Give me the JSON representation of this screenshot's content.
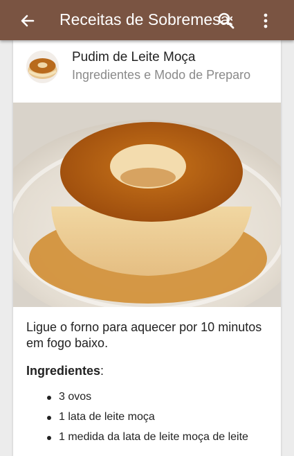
{
  "app_bar": {
    "title": "Receitas de Sobremesas",
    "bg_color": "#7a5442",
    "back_icon": "arrow-back-icon",
    "search_icon": "search-icon",
    "more_icon": "more-vert-icon"
  },
  "recipe": {
    "title": "Pudim de Leite Moça",
    "subtitle": "Ingredientes e Modo de Preparo",
    "intro": "Ligue o forno para aquecer por 10 minutos em fogo baixo.",
    "ingredients_heading": "Ingredientes",
    "ingredients_colon": ":",
    "ingredients": [
      "3 ovos",
      "1 lata de leite moça",
      "1 medida da lata de leite moça de leite"
    ]
  }
}
